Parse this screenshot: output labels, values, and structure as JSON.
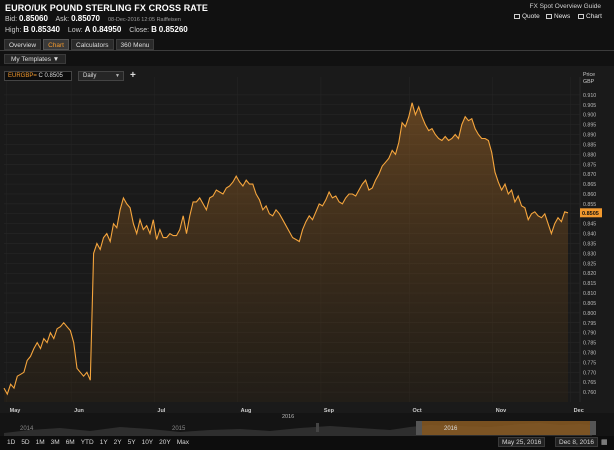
{
  "header": {
    "title": "EURO/UK POUND STERLING FX CROSS RATE",
    "guide_link": "FX Spot Overview Guide",
    "links": [
      "Quote",
      "News",
      "Chart"
    ],
    "bid_label": "Bid:",
    "bid": "0.85060",
    "ask_label": "Ask:",
    "ask": "0.85070",
    "timestamp": "08-Dec-2016   12:05 Raiffeisen",
    "high_label": "High:",
    "high_src": "B",
    "high": "0.85340",
    "low_label": "Low:",
    "low_src": "A",
    "low": "0.84950",
    "close_label": "Close:",
    "close_src": "B",
    "close": "0.85260"
  },
  "tabs": [
    "Overview",
    "Chart",
    "Calculators",
    "360 Menu"
  ],
  "active_tab": "Chart",
  "toolbar": {
    "templates_label": "My Templates ▼",
    "symbol": "EURGBP=",
    "symbol_value": "C 0.8505",
    "period": "Daily",
    "add_label": "+"
  },
  "colors": {
    "accent": "#f39a2e",
    "line": "#f5a53d",
    "background": "#1a1a1a"
  },
  "chart_data": {
    "type": "area",
    "title": "",
    "xlabel": "",
    "ylabel": "Price GBP",
    "ylim": [
      0.755,
      0.915
    ],
    "y_ticks": [
      0.76,
      0.765,
      0.77,
      0.775,
      0.78,
      0.785,
      0.79,
      0.795,
      0.8,
      0.805,
      0.81,
      0.815,
      0.82,
      0.825,
      0.83,
      0.835,
      0.84,
      0.845,
      0.85,
      0.855,
      0.86,
      0.865,
      0.87,
      0.875,
      0.88,
      0.885,
      0.89,
      0.895,
      0.9,
      0.905,
      0.91
    ],
    "x_tick_labels": [
      "May",
      "Jun",
      "Jul",
      "Aug",
      "Sep",
      "Oct",
      "Nov",
      "Dec"
    ],
    "current_value": "0.8505",
    "grid": true,
    "series": [
      {
        "values": [
          0.762,
          0.759,
          0.764,
          0.762,
          0.768,
          0.769,
          0.77,
          0.776,
          0.778,
          0.782,
          0.785,
          0.782,
          0.787,
          0.785,
          0.79,
          0.787,
          0.792,
          0.793,
          0.795,
          0.793,
          0.791,
          0.785,
          0.772,
          0.77,
          0.768,
          0.77,
          0.766,
          0.83,
          0.835,
          0.832,
          0.838,
          0.84,
          0.836,
          0.845,
          0.843,
          0.852,
          0.858,
          0.855,
          0.853,
          0.845,
          0.84,
          0.847,
          0.842,
          0.844,
          0.84,
          0.847,
          0.837,
          0.842,
          0.838,
          0.838,
          0.84,
          0.839,
          0.839,
          0.842,
          0.849,
          0.84,
          0.849,
          0.856,
          0.856,
          0.858,
          0.855,
          0.852,
          0.858,
          0.859,
          0.862,
          0.861,
          0.86,
          0.863,
          0.864,
          0.866,
          0.869,
          0.866,
          0.864,
          0.867,
          0.865,
          0.865,
          0.86,
          0.857,
          0.852,
          0.854,
          0.85,
          0.849,
          0.852,
          0.85,
          0.847,
          0.844,
          0.841,
          0.838,
          0.837,
          0.836,
          0.842,
          0.846,
          0.849,
          0.847,
          0.851,
          0.855,
          0.854,
          0.857,
          0.861,
          0.858,
          0.859,
          0.856,
          0.855,
          0.858,
          0.86,
          0.86,
          0.859,
          0.862,
          0.865,
          0.867,
          0.862,
          0.863,
          0.867,
          0.87,
          0.874,
          0.876,
          0.878,
          0.882,
          0.88,
          0.886,
          0.896,
          0.894,
          0.899,
          0.906,
          0.9,
          0.904,
          0.899,
          0.895,
          0.892,
          0.893,
          0.89,
          0.888,
          0.887,
          0.889,
          0.887,
          0.888,
          0.89,
          0.888,
          0.895,
          0.899,
          0.897,
          0.898,
          0.893,
          0.89,
          0.888,
          0.888,
          0.887,
          0.881,
          0.871,
          0.866,
          0.862,
          0.865,
          0.86,
          0.862,
          0.856,
          0.859,
          0.854,
          0.853,
          0.847,
          0.85,
          0.851,
          0.849,
          0.848,
          0.85,
          0.845,
          0.84,
          0.845,
          0.848,
          0.846,
          0.851,
          0.8505
        ]
      }
    ]
  },
  "navigator": {
    "years": [
      "2014",
      "2015",
      "2016",
      "2016"
    ]
  },
  "range_buttons": [
    "1D",
    "5D",
    "1M",
    "3M",
    "6M",
    "YTD",
    "1Y",
    "2Y",
    "5Y",
    "10Y",
    "20Y",
    "Max"
  ],
  "date_range": {
    "start": "May 25, 2016",
    "end": "Dec 8, 2016"
  }
}
